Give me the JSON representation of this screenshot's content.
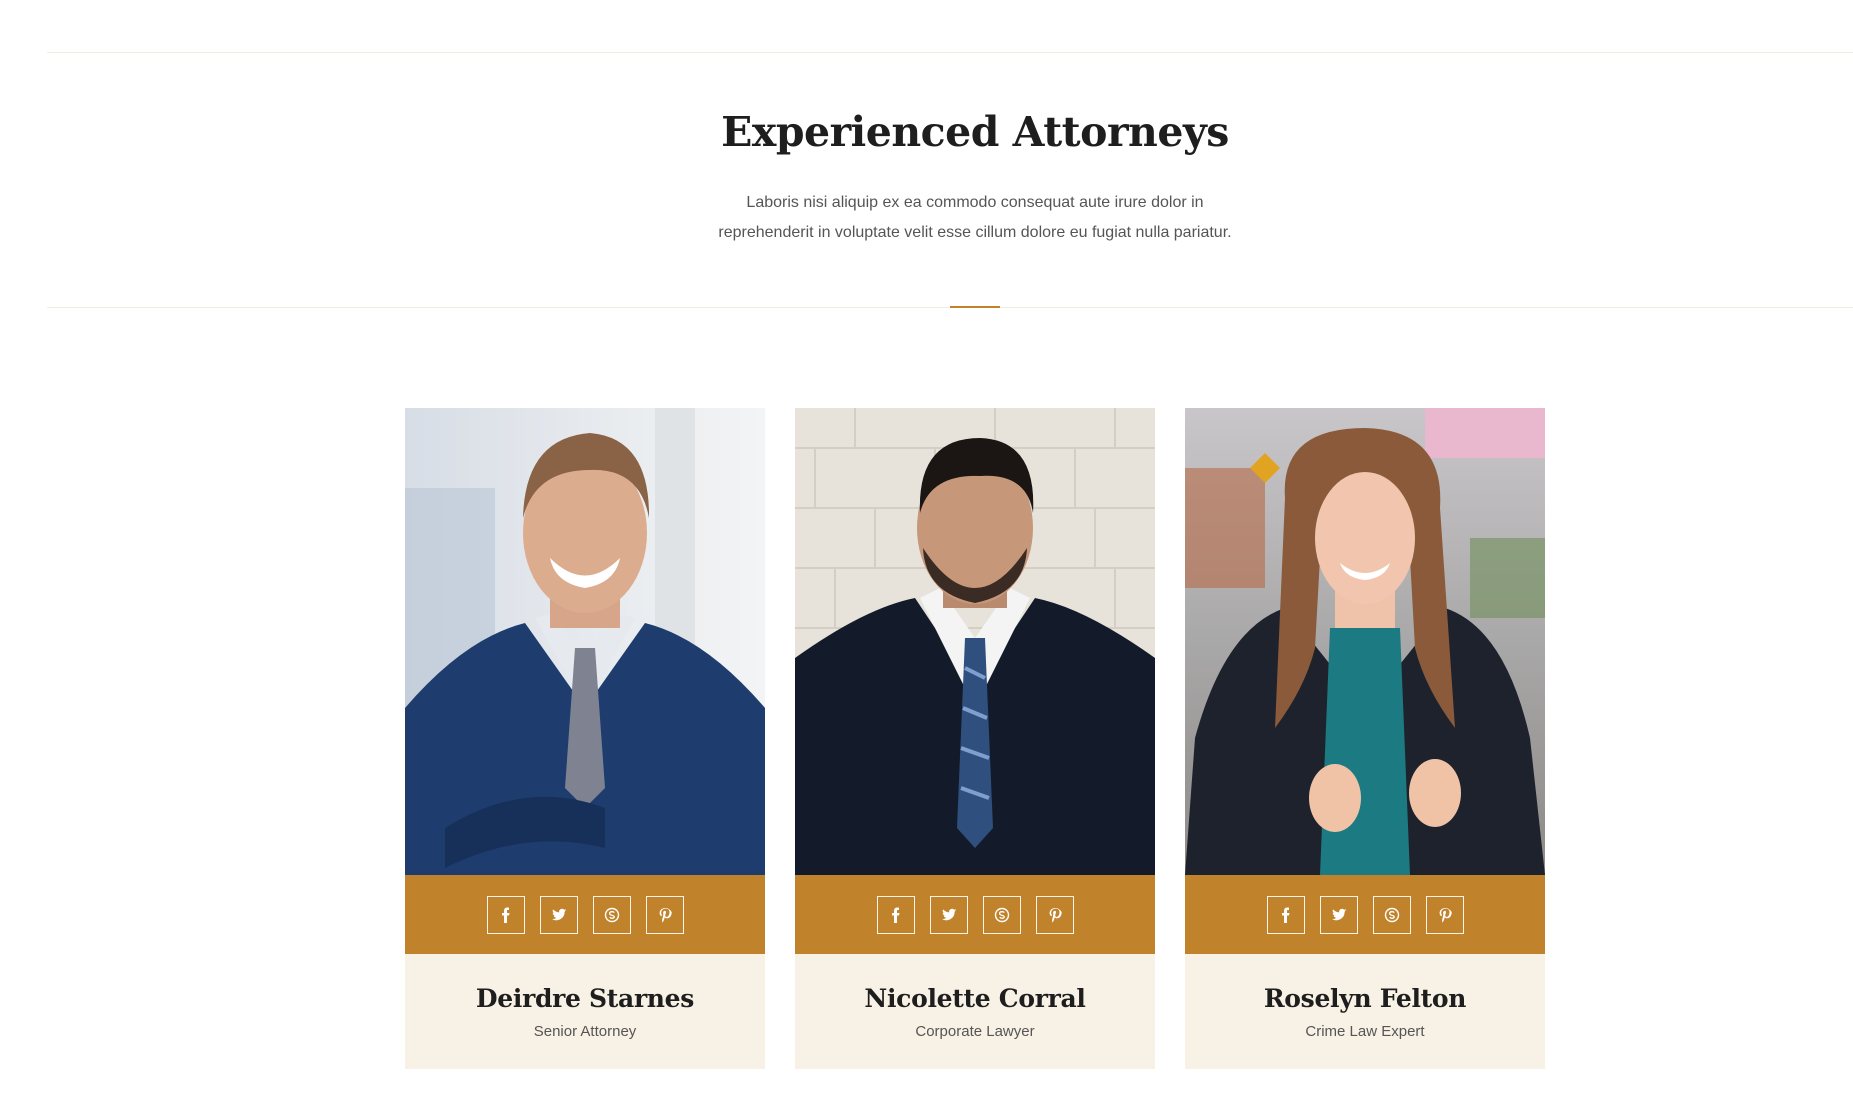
{
  "section": {
    "title": "Experienced Attorneys",
    "intro_line_1": "Laboris nisi aliquip ex ea commodo consequat aute irure dolor in",
    "intro_line_2": "reprehenderit in voluptate velit esse cillum dolore eu fugiat nulla pariatur."
  },
  "colors": {
    "accent": "#c0822b",
    "card_info_bg": "#f8f1e6",
    "heading": "#1e1e1e",
    "body_text": "#555555"
  },
  "social_icons": [
    "facebook-icon",
    "twitter-icon",
    "skype-icon",
    "pinterest-icon"
  ],
  "attorneys": [
    {
      "name": "Deirdre Starnes",
      "role": "Senior Attorney"
    },
    {
      "name": "Nicolette Corral",
      "role": "Corporate Lawyer"
    },
    {
      "name": "Roselyn Felton",
      "role": "Crime Law Expert"
    }
  ]
}
